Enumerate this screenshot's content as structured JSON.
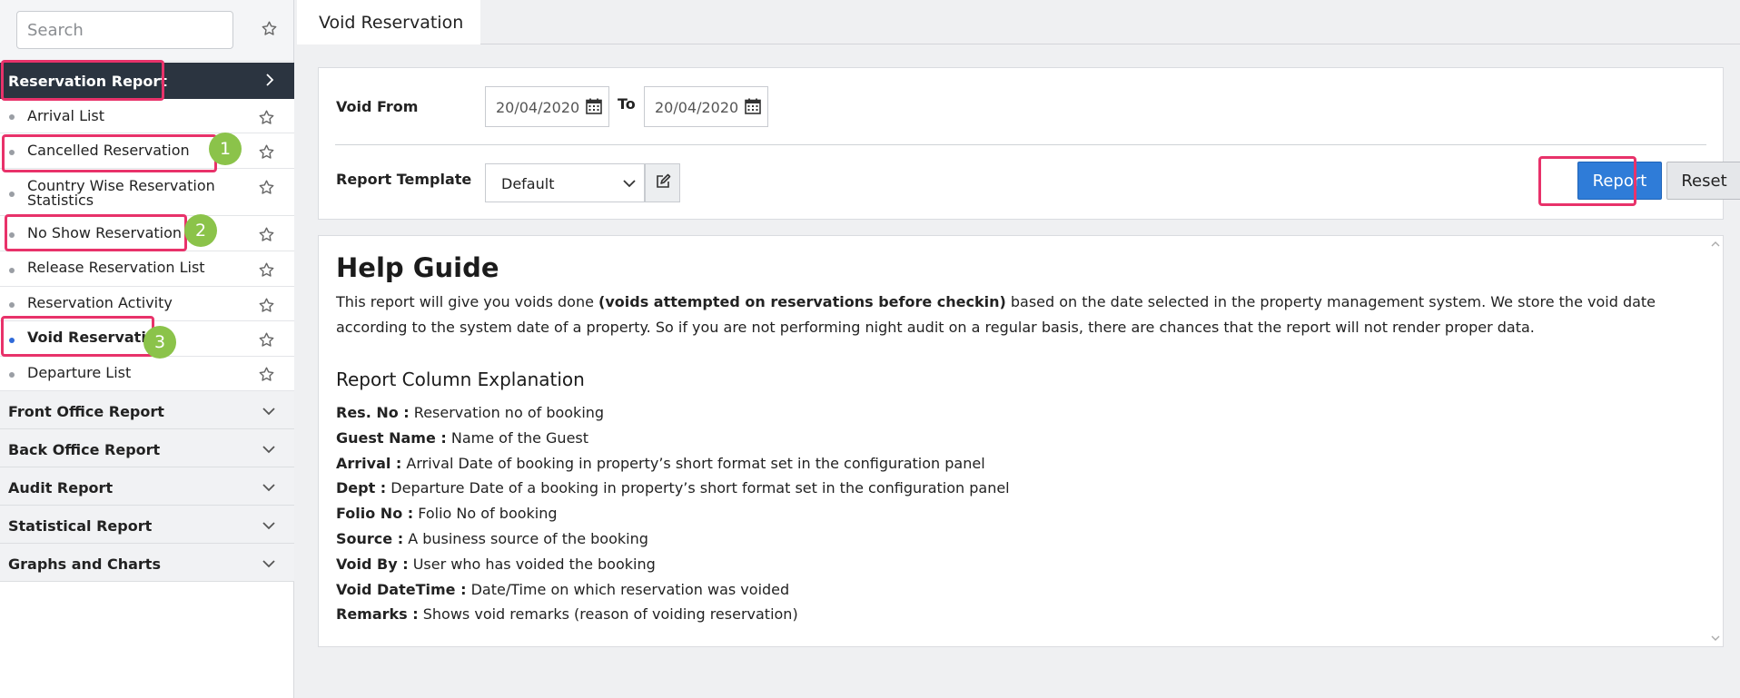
{
  "sidebar": {
    "search_placeholder": "Search",
    "active_section": "Reservation Report",
    "items": [
      {
        "label": "Arrival List",
        "label2": ""
      },
      {
        "label": "Cancelled Reservation",
        "label2": ""
      },
      {
        "label": "Country Wise Reservation",
        "label2": "Statistics"
      },
      {
        "label": "No Show Reservation",
        "label2": ""
      },
      {
        "label": "Release Reservation List",
        "label2": ""
      },
      {
        "label": "Reservation Activity",
        "label2": ""
      },
      {
        "label": "Void Reservation",
        "label2": ""
      },
      {
        "label": "Departure List",
        "label2": ""
      }
    ],
    "sections": [
      "Front Office Report",
      "Back Office Report",
      "Audit Report",
      "Statistical Report",
      "Graphs and Charts"
    ]
  },
  "annotations": {
    "badges": [
      "1",
      "2",
      "3"
    ],
    "highlight_color": "#e8326a",
    "badge_color": "#8bc34a"
  },
  "tab": {
    "title": "Void Reservation"
  },
  "filters": {
    "void_from_label": "Void From",
    "from_date": "20/04/2020",
    "to_label": "To",
    "to_date": "20/04/2020",
    "template_label": "Report Template",
    "template_value": "Default",
    "report_button": "Report",
    "reset_button": "Reset",
    "accent_color": "#2f7cd8"
  },
  "help": {
    "title": "Help Guide",
    "intro_before": "This report will give you voids done ",
    "intro_bold": "(voids attempted on reservations before checkin)",
    "intro_after": " based on the date selected in the property management system. We store the void date according to the system date of a property. So if you are not performing night audit on a regular basis, there are chances that the report will not render proper data.",
    "columns_title": "Report Column Explanation",
    "columns": [
      {
        "key": "Res. No :",
        "desc": " Reservation no of booking"
      },
      {
        "key": "Guest Name :",
        "desc": " Name of the Guest"
      },
      {
        "key": "Arrival :",
        "desc": " Arrival Date of booking in property’s short format set in the configuration panel"
      },
      {
        "key": "Dept :",
        "desc": " Departure Date of a booking in property’s short format set in the configuration panel"
      },
      {
        "key": "Folio No :",
        "desc": " Folio No of booking"
      },
      {
        "key": "Source :",
        "desc": " A business source of the booking"
      },
      {
        "key": "Void By :",
        "desc": " User who has voided the booking"
      },
      {
        "key": "Void DateTime :",
        "desc": " Date/Time on which reservation was voided"
      },
      {
        "key": "Remarks :",
        "desc": " Shows void remarks (reason of voiding reservation)"
      }
    ]
  }
}
